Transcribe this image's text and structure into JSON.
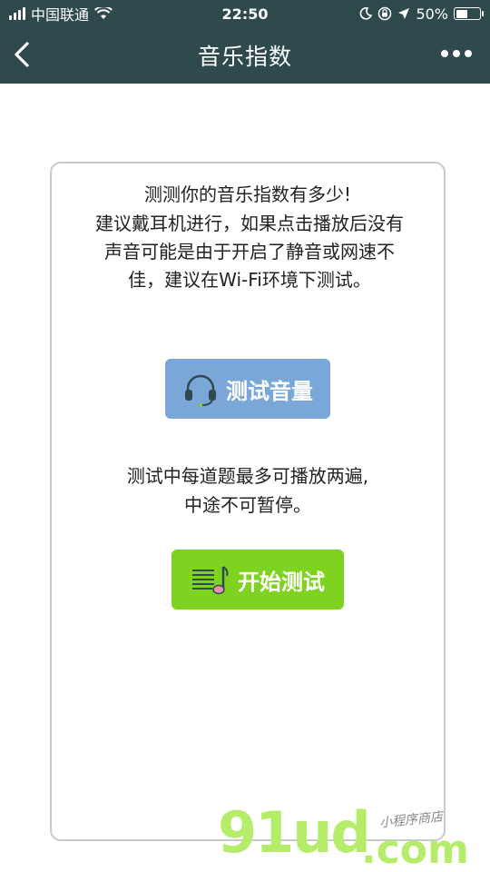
{
  "status_bar": {
    "carrier": "中国联通",
    "time": "22:50",
    "battery": "50%",
    "battery_level": 0.5
  },
  "nav": {
    "title": "音乐指数",
    "back_icon": "chevron-left-icon",
    "more_icon": "more-dots-icon"
  },
  "content": {
    "intro_title": "测测你的音乐指数有多少!",
    "intro_body": "建议戴耳机进行，如果点击播放后没有声音可能是由于开启了静音或网速不佳，建议在Wi-Fi环境下测试。",
    "volume_button_label": "测试音量",
    "volume_button_icon": "headphones-icon",
    "note_line1": "测试中每道题最多可播放两遍,",
    "note_line2": "中途不可暂停。",
    "start_button_label": "开始测试",
    "start_button_icon": "music-note-icon"
  },
  "watermark": {
    "logo": "91ud",
    "domain": ".com",
    "subtitle": "小程序商店"
  },
  "colors": {
    "nav_bg": "#2f4a4d",
    "volume_button": "#7aa7d8",
    "start_button": "#7ed321",
    "watermark": "#b5ec6a"
  }
}
